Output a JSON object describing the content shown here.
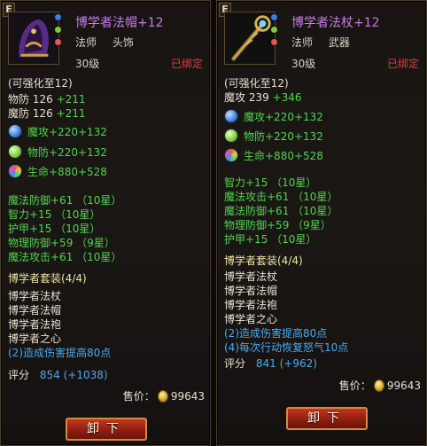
{
  "left": {
    "corner_tag": "E",
    "name": "博学者法帽+12",
    "cls": "法师",
    "slot": "头饰",
    "level": "30级",
    "bound": "已绑定",
    "enhance": "(可强化至12)",
    "base_stats": [
      {
        "label": "物防 126",
        "bonus": "+211"
      },
      {
        "label": "魔防 126",
        "bonus": "+211"
      }
    ],
    "gems": [
      {
        "text": "魔攻+220+132",
        "icon": "blue-gem-icon",
        "color": "#3f7de0"
      },
      {
        "text": "物防+220+132",
        "icon": "green-gem-icon",
        "color": "#7ccc3a"
      },
      {
        "text": "生命+880+528",
        "icon": "rainbow-gem-icon",
        "color": "#e07aa8"
      }
    ],
    "extra_stats": [
      "魔法防御+61 （10星）",
      "智力+15 （10星）",
      "护甲+15 （10星）",
      "物理防御+59 （9星）",
      "魔法攻击+61 （10星）"
    ],
    "set_title": "博学者套装(4/4)",
    "set_items": [
      "博学者法杖",
      "博学者法帽",
      "博学者法袍",
      "博学者之心"
    ],
    "set_bonus": [
      "(2)造成伤害提高80点"
    ],
    "score_label": "评分",
    "score_value": "854",
    "score_bonus": "(+1038)",
    "price_label": "售价：",
    "price_value": "99643",
    "unequip_label": "卸下"
  },
  "right": {
    "corner_tag": "E",
    "name": "博学者法杖+12",
    "cls": "法师",
    "slot": "武器",
    "level": "30级",
    "bound": "已绑定",
    "enhance": "(可强化至12)",
    "base_stats": [
      {
        "label": "魔攻 239",
        "bonus": "+346"
      }
    ],
    "gems": [
      {
        "text": "魔攻+220+132",
        "icon": "blue-gem-icon",
        "color": "#3f7de0"
      },
      {
        "text": "物防+220+132",
        "icon": "green-gem-icon",
        "color": "#7ccc3a"
      },
      {
        "text": "生命+880+528",
        "icon": "rainbow-gem-icon",
        "color": "#e07aa8"
      }
    ],
    "extra_stats": [
      "智力+15 （10星）",
      "魔法攻击+61 （10星）",
      "魔法防御+61 （10星）",
      "物理防御+59 （9星）",
      "护甲+15 （10星）"
    ],
    "set_title": "博学者套装(4/4)",
    "set_items": [
      "博学者法杖",
      "博学者法帽",
      "博学者法袍",
      "博学者之心"
    ],
    "set_bonus": [
      "(2)造成伤害提高80点",
      "(4)每次行动恢复怒气10点"
    ],
    "score_label": "评分",
    "score_value": "841",
    "score_bonus": "(+962)",
    "price_label": "售价：",
    "price_value": "99643",
    "unequip_label": "卸下"
  },
  "colors": {
    "purple_name": "#c47be8",
    "green_bonus": "#4ed64e",
    "bound_red": "#e33b3b",
    "set_yellow": "#ece5a6",
    "set_bonus_blue": "#4aa9f0"
  }
}
